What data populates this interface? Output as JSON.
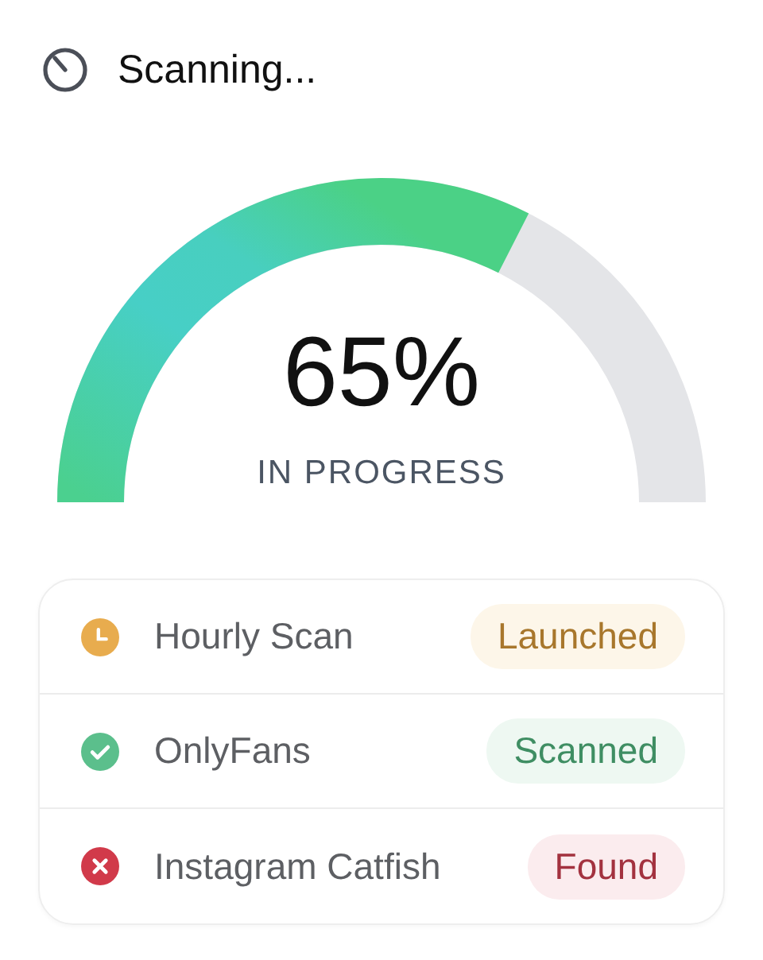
{
  "header": {
    "title": "Scanning..."
  },
  "gauge": {
    "value": "65%",
    "label": "IN PROGRESS"
  },
  "scans": [
    {
      "name": "Hourly Scan",
      "status": "Launched",
      "kind": "launched"
    },
    {
      "name": "OnlyFans",
      "status": "Scanned",
      "kind": "scanned"
    },
    {
      "name": "Instagram Catfish",
      "status": "Found",
      "kind": "found"
    }
  ]
}
